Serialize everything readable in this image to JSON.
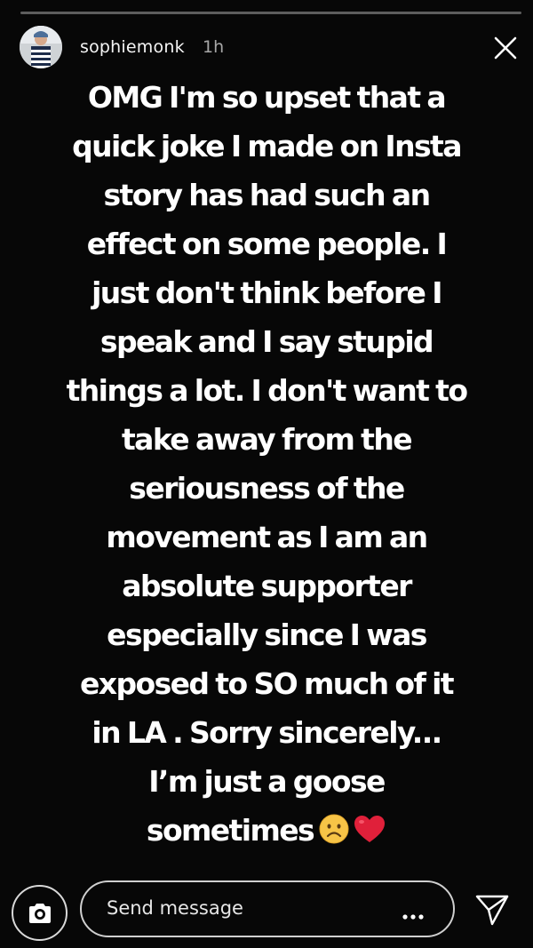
{
  "story": {
    "progress": 0.0,
    "username": "sophiemonk",
    "timestamp": "1h",
    "lines": [
      "OMG I'm so upset that a",
      "quick joke I made on Insta",
      "story has had such an",
      "effect on some people. I",
      "just don't think before I",
      "speak and I say stupid",
      "things a lot. I don't want to",
      "take away from the",
      "seriousness of the",
      "movement as I am an",
      "absolute supporter",
      "especially since I was",
      "exposed to SO much of it",
      "in LA . Sorry sincerely...",
      "I’m just a goose",
      "sometimes"
    ],
    "emojis": [
      "frowning-face",
      "red-heart"
    ]
  },
  "footer": {
    "message_placeholder": "Send message",
    "icons": [
      "camera-icon",
      "more-options-icon",
      "send-icon"
    ]
  },
  "colors": {
    "background": "#070707",
    "text": "#ffffff",
    "heart": "#e0203a",
    "emoji_face": "#f7c447"
  }
}
